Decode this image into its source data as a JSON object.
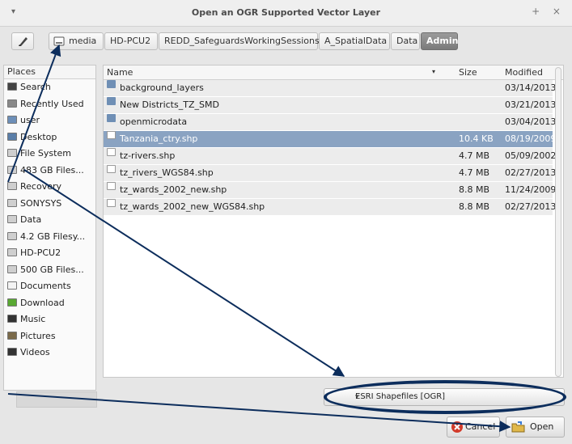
{
  "window": {
    "title": "Open an OGR Supported Vector Layer",
    "left_glyph": "▾",
    "right_glyphs": "+ ×"
  },
  "pathbar": {
    "edit_icon": "pencil-icon",
    "drive_icon": "drive-icon",
    "crumbs": [
      "media",
      "HD-PCU2",
      "REDD_SafeguardsWorkingSessions",
      "A_SpatialData",
      "Data",
      "Admin"
    ]
  },
  "places": {
    "header": "Places",
    "items": [
      {
        "label": "Search",
        "icon": "search-icon"
      },
      {
        "label": "Recently Used",
        "icon": "clock-icon"
      },
      {
        "label": "user",
        "icon": "home-icon"
      },
      {
        "label": "Desktop",
        "icon": "desktop-icon"
      },
      {
        "label": "File System",
        "icon": "drive-icon"
      },
      {
        "label": "483 GB Files...",
        "icon": "drive-icon"
      },
      {
        "label": "Recovery",
        "icon": "drive-icon"
      },
      {
        "label": "SONYSYS",
        "icon": "drive-icon"
      },
      {
        "label": "Data",
        "icon": "drive-icon"
      },
      {
        "label": "4.2 GB Filesy...",
        "icon": "drive-icon"
      },
      {
        "label": "HD-PCU2",
        "icon": "drive-icon"
      },
      {
        "label": "500 GB Files...",
        "icon": "drive-icon"
      },
      {
        "label": "Documents",
        "icon": "documents-icon"
      },
      {
        "label": "Download",
        "icon": "download-icon"
      },
      {
        "label": "Music",
        "icon": "music-icon"
      },
      {
        "label": "Pictures",
        "icon": "pictures-icon"
      },
      {
        "label": "Videos",
        "icon": "videos-icon"
      }
    ]
  },
  "files": {
    "headers": {
      "name": "Name",
      "sort": "▾",
      "size": "Size",
      "modified": "Modified"
    },
    "rows": [
      {
        "name": "background_layers",
        "size": "",
        "modified": "03/14/2013",
        "type": "folder"
      },
      {
        "name": "New Districts_TZ_SMD",
        "size": "",
        "modified": "03/21/2013",
        "type": "folder"
      },
      {
        "name": "openmicrodata",
        "size": "",
        "modified": "03/04/2013",
        "type": "folder"
      },
      {
        "name": "Tanzania_ctry.shp",
        "size": "10.4 KB",
        "modified": "08/19/2009",
        "type": "file",
        "selected": true
      },
      {
        "name": "tz-rivers.shp",
        "size": "4.7 MB",
        "modified": "05/09/2002",
        "type": "file"
      },
      {
        "name": "tz_rivers_WGS84.shp",
        "size": "4.7 MB",
        "modified": "02/27/2013",
        "type": "file"
      },
      {
        "name": "tz_wards_2002_new.shp",
        "size": "8.8 MB",
        "modified": "11/24/2009",
        "type": "file"
      },
      {
        "name": "tz_wards_2002_new_WGS84.shp",
        "size": "8.8 MB",
        "modified": "02/27/2013",
        "type": "file"
      }
    ]
  },
  "filter": {
    "value": "ESRI Shapefiles [OGR]"
  },
  "buttons": {
    "cancel": "Cancel",
    "open": "Open"
  },
  "colors": {
    "selection": "#8aa3c2",
    "annotation": "#0c2d5c",
    "cancel_icon": "#d23b2a"
  }
}
